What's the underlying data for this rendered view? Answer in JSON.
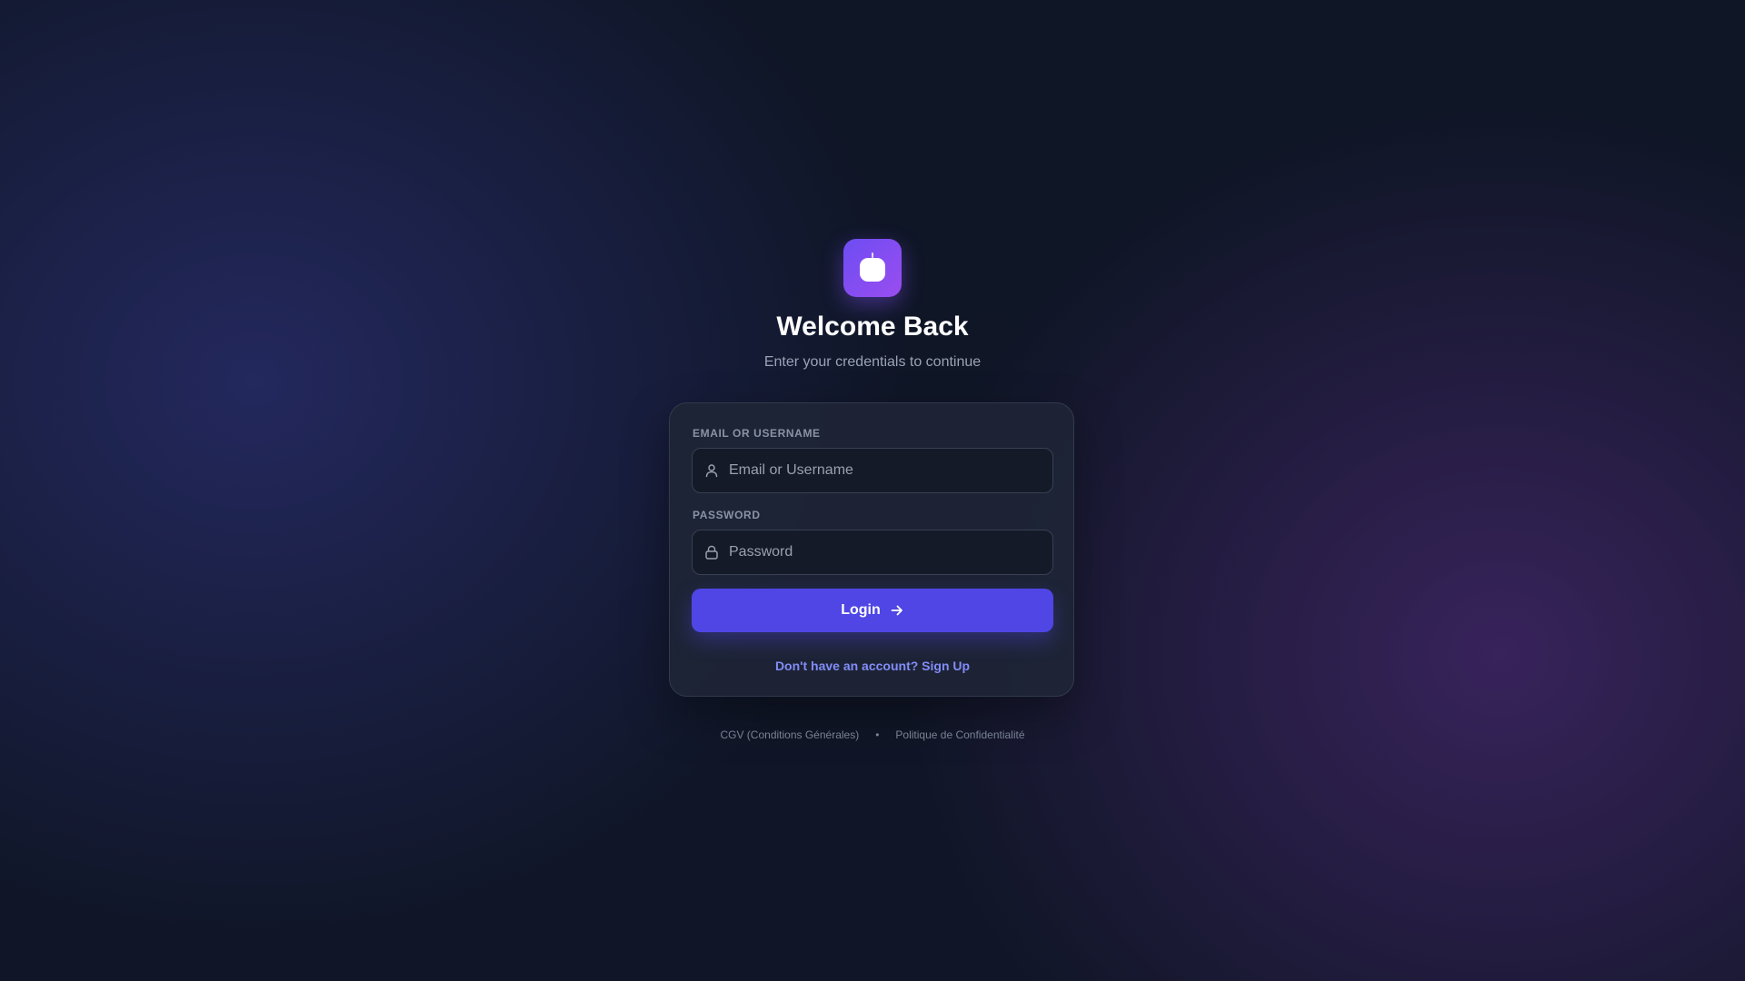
{
  "app": {
    "logo_icon": "apple-icon"
  },
  "header": {
    "title": "Welcome Back",
    "subtitle": "Enter your credentials to continue"
  },
  "form": {
    "email": {
      "label": "EMAIL OR USERNAME",
      "placeholder": "Email or Username",
      "value": "",
      "icon": "user-icon"
    },
    "password": {
      "label": "PASSWORD",
      "placeholder": "Password",
      "value": "",
      "icon": "lock-icon"
    },
    "login_button": {
      "label": "Login",
      "icon": "arrow-right-icon"
    },
    "signup_link": "Don't have an account? Sign Up"
  },
  "footer": {
    "links": [
      "CGV (Conditions Générales)",
      "Politique de Confidentialité"
    ],
    "separator": "•"
  },
  "colors": {
    "accent": "#4f46e5",
    "link": "#818cf8",
    "logo_gradient_start": "#6d4df2",
    "logo_gradient_end": "#9a4df0",
    "card_background": "#1e2536",
    "page_background": "#0f1626"
  }
}
